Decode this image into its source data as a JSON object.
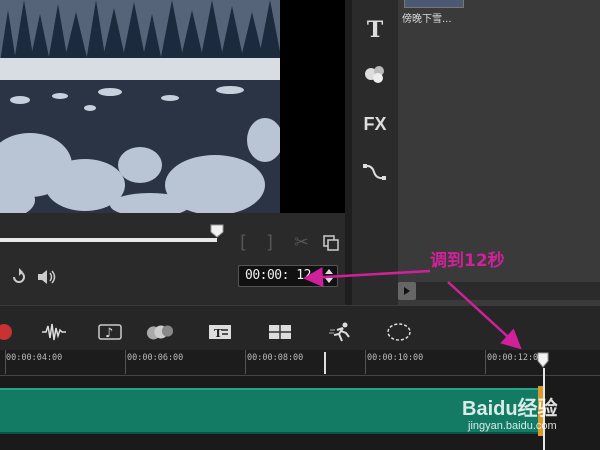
{
  "library": {
    "thumbnail_label": "傍晚下雪..."
  },
  "sidebar": {
    "items": [
      {
        "name": "title-icon",
        "glyph": "T"
      },
      {
        "name": "transition-icon",
        "glyph": "✿"
      },
      {
        "name": "fx-icon",
        "glyph": "FX"
      },
      {
        "name": "path-icon",
        "glyph": "path"
      }
    ]
  },
  "preview": {
    "timecode": "00:00: 12:",
    "scrub_position": 0.62
  },
  "timeline": {
    "toolbar_icons": [
      "record-icon",
      "audio-wave-icon",
      "music-clef-icon",
      "color-circles-icon",
      "title-track-icon",
      "split-screen-icon",
      "running-man-icon",
      "motion-path-icon"
    ],
    "ruler_labels": [
      "00:00:04:00",
      "00:00:06:00",
      "00:00:08:00",
      "00:00:10:00",
      "00:00:12:00"
    ],
    "clip_color": "#137a64"
  },
  "annotation": {
    "text": "调到12秒",
    "color": "#d0219a"
  },
  "watermark": {
    "line1": "Baidu经验",
    "line2": "jingyan.baidu.com"
  }
}
